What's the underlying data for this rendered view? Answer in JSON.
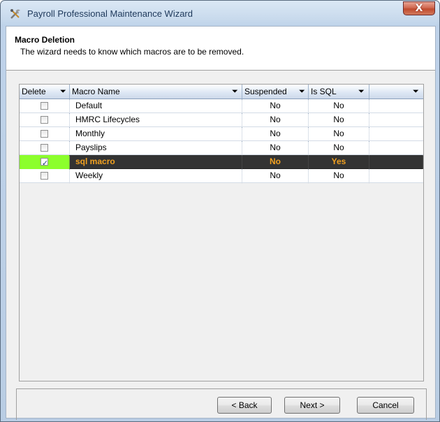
{
  "window": {
    "title": "Payroll Professional Maintenance Wizard",
    "close_label": "X"
  },
  "header": {
    "title": "Macro Deletion",
    "subtitle": "The wizard needs to know which macros are to be removed."
  },
  "grid": {
    "columns": [
      "Delete",
      "Macro Name",
      "Suspended",
      "Is SQL",
      ""
    ],
    "rows": [
      {
        "delete": false,
        "name": "Default",
        "suspended": "No",
        "is_sql": "No"
      },
      {
        "delete": false,
        "name": "HMRC Lifecycles",
        "suspended": "No",
        "is_sql": "No"
      },
      {
        "delete": false,
        "name": "Monthly",
        "suspended": "No",
        "is_sql": "No"
      },
      {
        "delete": false,
        "name": "Payslips",
        "suspended": "No",
        "is_sql": "No"
      },
      {
        "delete": true,
        "name": "sql macro",
        "suspended": "No",
        "is_sql": "Yes",
        "selected": true
      },
      {
        "delete": false,
        "name": "Weekly",
        "suspended": "No",
        "is_sql": "No"
      }
    ]
  },
  "buttons": {
    "back": "< Back",
    "next": "Next >",
    "cancel": "Cancel"
  },
  "colors": {
    "selected_row_bg": "#333333",
    "selected_text": "#f0a020",
    "selected_check_cell": "#8cff2c"
  }
}
